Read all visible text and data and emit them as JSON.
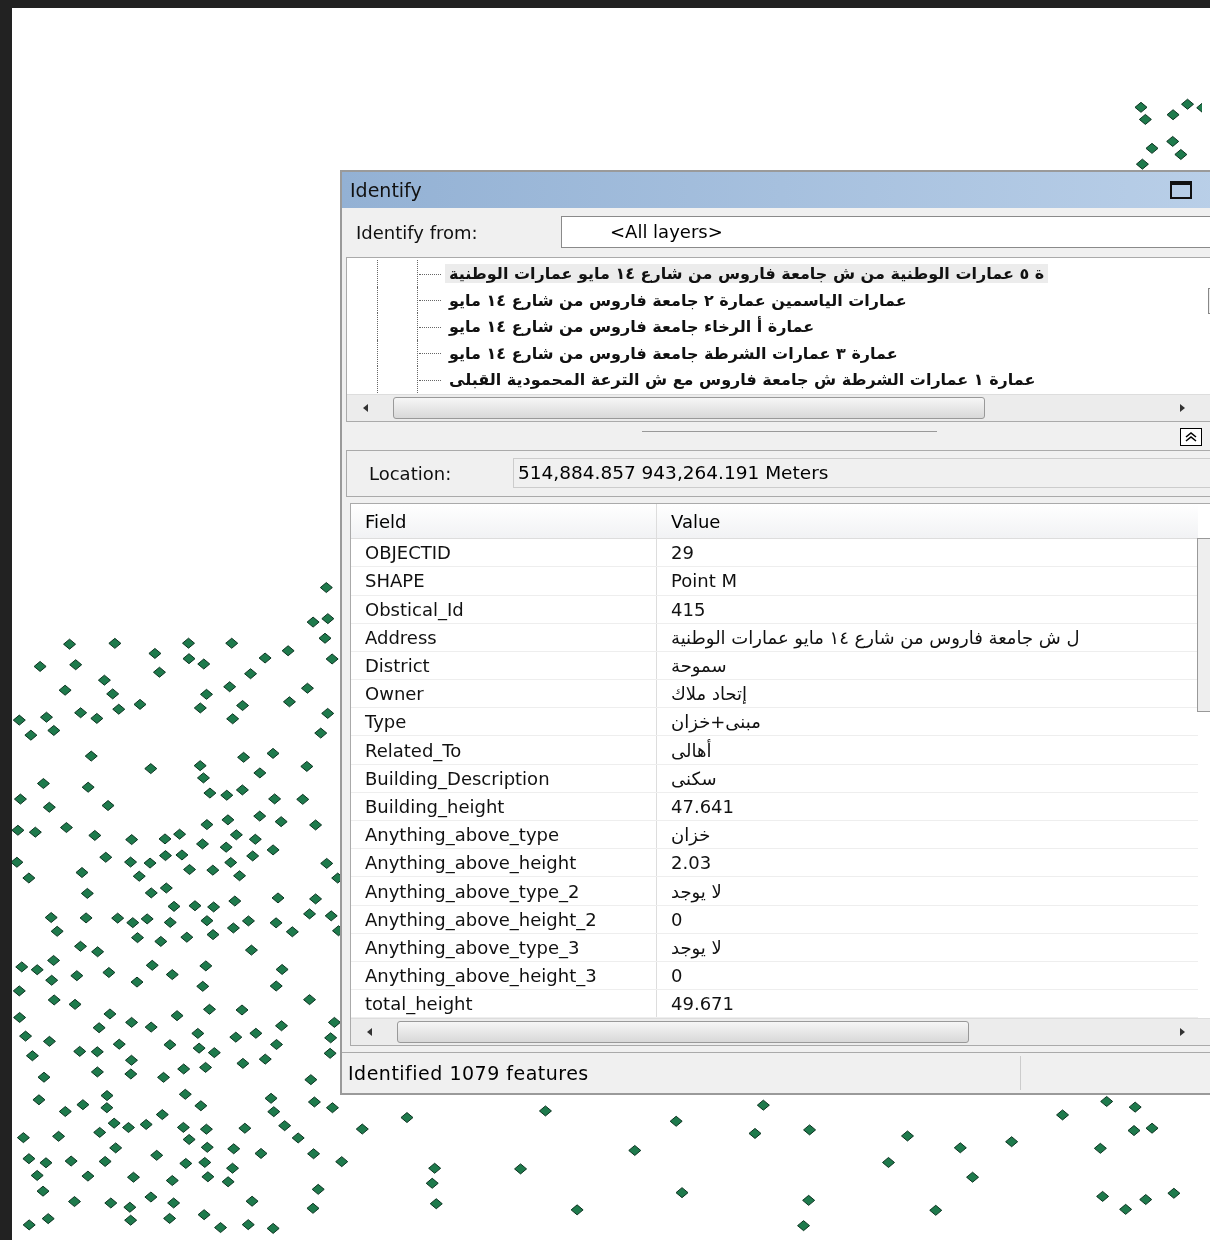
{
  "window": {
    "title": "Identify"
  },
  "identify_from": {
    "label": "Identify from:",
    "value": "<All layers>"
  },
  "tree": {
    "items": [
      {
        "label": "ة ٥ عمارات الوطنية من ش جامعة فاروس من شارع ١٤ مايو عمارات الوطنية",
        "selected": true
      },
      {
        "label": "عمارات الياسمين  عمارة ٢ جامعة فاروس من شارع ١٤ مايو",
        "selected": false
      },
      {
        "label": "عمارة أ الرخاء جامعة فاروس من شارع ١٤ مايو",
        "selected": false
      },
      {
        "label": "عمارة ٣ عمارات الشرطة جامعة فاروس من شارع ١٤ مايو",
        "selected": false
      },
      {
        "label": "عمارة ١  عمارات الشرطة ش جامعة فاروس مع ش الترعة المحمودية القبلى",
        "selected": false
      }
    ]
  },
  "location": {
    "label": "Location:",
    "value": "514,884.857  943,264.191 Meters"
  },
  "attributes": {
    "field_header": "Field",
    "value_header": "Value",
    "items": [
      {
        "field": "OBJECTID",
        "value": "29"
      },
      {
        "field": "SHAPE",
        "value": "Point M"
      },
      {
        "field": "Obstical_Id",
        "value": "415"
      },
      {
        "field": "Address",
        "value": "ل ش جامعة فاروس من شارع ١٤ مايو عمارات الوطنية"
      },
      {
        "field": "District",
        "value": "سموحة"
      },
      {
        "field": "Owner",
        "value": "إتحاد ملاك"
      },
      {
        "field": "Type",
        "value": "مبنى+خزان"
      },
      {
        "field": "Related_To",
        "value": "أهالى"
      },
      {
        "field": "Building_Description",
        "value": "سكنى"
      },
      {
        "field": "Building_height",
        "value": "47.641"
      },
      {
        "field": "Anything_above_type",
        "value": "خزان"
      },
      {
        "field": "Anything_above_height",
        "value": "2.03"
      },
      {
        "field": "Anything_above_type_2",
        "value": "لا يوجد"
      },
      {
        "field": "Anything_above_height_2",
        "value": "0"
      },
      {
        "field": "Anything_above_type_3",
        "value": "لا يوجد"
      },
      {
        "field": "Anything_above_height_3",
        "value": "0"
      },
      {
        "field": "total_height",
        "value": "49.671"
      }
    ]
  },
  "status_bar": "Identified 1079 features"
}
